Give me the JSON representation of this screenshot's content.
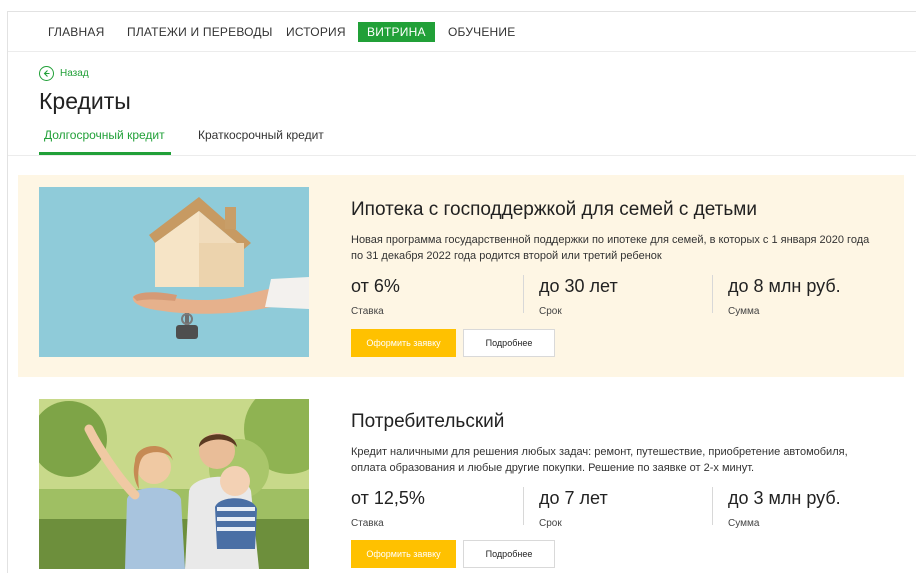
{
  "nav": {
    "items": [
      {
        "label": "ГЛАВНАЯ"
      },
      {
        "label": "ПЛАТЕЖИ И ПЕРЕВОДЫ"
      },
      {
        "label": "ИСТОРИЯ"
      },
      {
        "label": "ВИТРИНА"
      },
      {
        "label": "ОБУЧЕНИЕ"
      }
    ],
    "active_index": 3
  },
  "back": {
    "label": "Назад",
    "icon": "arrow-left-icon"
  },
  "page_title": "Кредиты",
  "tabs": [
    {
      "label": "Долгосрочный кредит"
    },
    {
      "label": "Краткосрочный кредит"
    }
  ],
  "cards": [
    {
      "title": "Ипотека с господдержкой для семей с детьми",
      "description": "Новая программа государственной поддержки по ипотеке для семей, в которых с 1 января 2020 года по 31 декабря 2022 года родится второй или третий ребенок",
      "stats": [
        {
          "value": "от 6%",
          "label": "Ставка"
        },
        {
          "value": "до 30 лет",
          "label": "Срок"
        },
        {
          "value": "до 8 млн руб.",
          "label": "Сумма"
        }
      ],
      "apply_label": "Оформить заявку",
      "more_label": "Подробнее",
      "image": "house-in-hand-photo"
    },
    {
      "title": "Потребительский",
      "description": "Кредит наличными для решения любых задач: ремонт, путешествие, приобретение автомобиля, оплата образования и любые другие покупки. Решение по заявке от 2-х минут.",
      "stats": [
        {
          "value": "от 12,5%",
          "label": "Ставка"
        },
        {
          "value": "до 7 лет",
          "label": "Срок"
        },
        {
          "value": "до 3 млн руб.",
          "label": "Сумма"
        }
      ],
      "apply_label": "Оформить заявку",
      "more_label": "Подробнее",
      "image": "family-photo"
    }
  ],
  "colors": {
    "accent": "#21a038",
    "button": "#ffc100",
    "highlight_bg": "#fef6e4"
  }
}
